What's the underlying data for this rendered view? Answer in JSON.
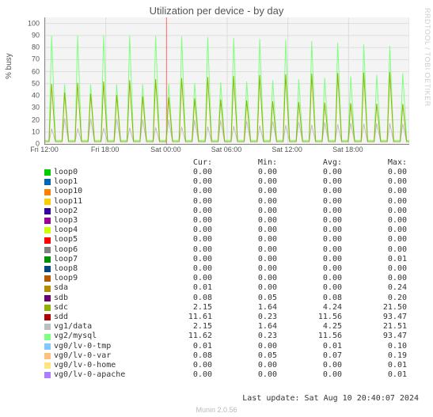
{
  "chart_data": {
    "type": "line",
    "title": "Utilization per device - by day",
    "ylabel": "% busy",
    "ylim": [
      0,
      105
    ],
    "yticks": [
      0,
      10,
      20,
      30,
      40,
      50,
      60,
      70,
      80,
      90,
      100
    ],
    "xticks": [
      "Fri 12:00",
      "Fri 18:00",
      "Sat 00:00",
      "Sat 06:00",
      "Sat 12:00",
      "Sat 18:00"
    ],
    "series": [
      {
        "name": "loop0",
        "color": "#00cc00",
        "cur": "0.00",
        "min": "0.00",
        "avg": "0.00",
        "max": "0.00"
      },
      {
        "name": "loop1",
        "color": "#0066b3",
        "cur": "0.00",
        "min": "0.00",
        "avg": "0.00",
        "max": "0.00"
      },
      {
        "name": "loop10",
        "color": "#ff8000",
        "cur": "0.00",
        "min": "0.00",
        "avg": "0.00",
        "max": "0.00"
      },
      {
        "name": "loop11",
        "color": "#ffcc00",
        "cur": "0.00",
        "min": "0.00",
        "avg": "0.00",
        "max": "0.00"
      },
      {
        "name": "loop2",
        "color": "#330099",
        "cur": "0.00",
        "min": "0.00",
        "avg": "0.00",
        "max": "0.00"
      },
      {
        "name": "loop3",
        "color": "#990099",
        "cur": "0.00",
        "min": "0.00",
        "avg": "0.00",
        "max": "0.00"
      },
      {
        "name": "loop4",
        "color": "#ccff00",
        "cur": "0.00",
        "min": "0.00",
        "avg": "0.00",
        "max": "0.00"
      },
      {
        "name": "loop5",
        "color": "#ff0000",
        "cur": "0.00",
        "min": "0.00",
        "avg": "0.00",
        "max": "0.00"
      },
      {
        "name": "loop6",
        "color": "#808080",
        "cur": "0.00",
        "min": "0.00",
        "avg": "0.00",
        "max": "0.00"
      },
      {
        "name": "loop7",
        "color": "#008f00",
        "cur": "0.00",
        "min": "0.00",
        "avg": "0.00",
        "max": "0.01"
      },
      {
        "name": "loop8",
        "color": "#00487d",
        "cur": "0.00",
        "min": "0.00",
        "avg": "0.00",
        "max": "0.00"
      },
      {
        "name": "loop9",
        "color": "#b35a00",
        "cur": "0.00",
        "min": "0.00",
        "avg": "0.00",
        "max": "0.00"
      },
      {
        "name": "sda",
        "color": "#b38f00",
        "cur": "0.01",
        "min": "0.00",
        "avg": "0.00",
        "max": "0.24"
      },
      {
        "name": "sdb",
        "color": "#6b006b",
        "cur": "0.08",
        "min": "0.05",
        "avg": "0.08",
        "max": "0.20"
      },
      {
        "name": "sdc",
        "color": "#8fb300",
        "cur": "2.15",
        "min": "1.64",
        "avg": "4.24",
        "max": "21.50"
      },
      {
        "name": "sdd",
        "color": "#b30000",
        "cur": "11.61",
        "min": "0.23",
        "avg": "11.56",
        "max": "93.47"
      },
      {
        "name": "vg1/data",
        "color": "#bebebe",
        "cur": "2.15",
        "min": "1.64",
        "avg": "4.25",
        "max": "21.51"
      },
      {
        "name": "vg2/mysql",
        "color": "#80ff80",
        "cur": "11.62",
        "min": "0.23",
        "avg": "11.56",
        "max": "93.47"
      },
      {
        "name": "vg0/lv-0-tmp",
        "color": "#80c9ff",
        "cur": "0.01",
        "min": "0.00",
        "avg": "0.01",
        "max": "0.10"
      },
      {
        "name": "vg0/lv-0-var",
        "color": "#ffc080",
        "cur": "0.08",
        "min": "0.05",
        "avg": "0.07",
        "max": "0.19"
      },
      {
        "name": "vg0/lv-0-home",
        "color": "#ffe680",
        "cur": "0.00",
        "min": "0.00",
        "avg": "0.00",
        "max": "0.01"
      },
      {
        "name": "vg0/lv-0-apache",
        "color": "#aa80ff",
        "cur": "0.00",
        "min": "0.00",
        "avg": "0.00",
        "max": "0.01"
      }
    ],
    "stat_columns": [
      "Cur:",
      "Min:",
      "Avg:",
      "Max:"
    ]
  },
  "footer": {
    "last_update": "Last update: Sat Aug 10 20:40:07 2024",
    "version": "Munin 2.0.56"
  },
  "watermark": "RRDTOOL / TOBI OETIKER"
}
